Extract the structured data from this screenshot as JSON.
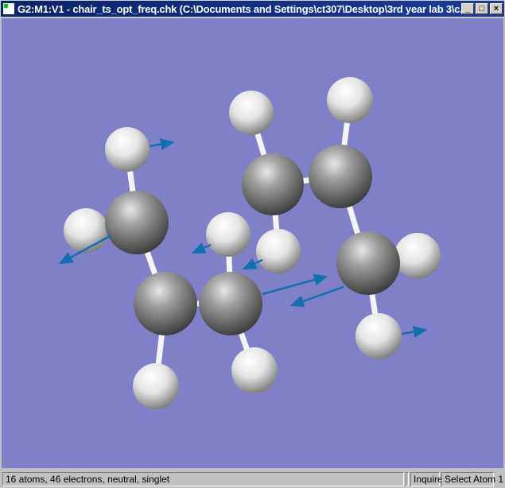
{
  "window": {
    "title": "G2:M1:V1 - chair_ts_opt_freq.chk (C:\\Documents and Settings\\ct307\\Desktop\\3rd year lab 3\\c...",
    "minimize_icon": "minimize-icon",
    "maximize_icon": "maximize-icon",
    "close_icon": "close-icon"
  },
  "colors": {
    "background": "#8080c8",
    "carbon": "#808080",
    "hydrogen": "#f0f0f0",
    "displacement_arrow": "#1070b0"
  },
  "statusbar": {
    "info": "16 atoms, 46 electrons, neutral, singlet",
    "mode": "Inquire",
    "action": "Select Atom 1"
  }
}
